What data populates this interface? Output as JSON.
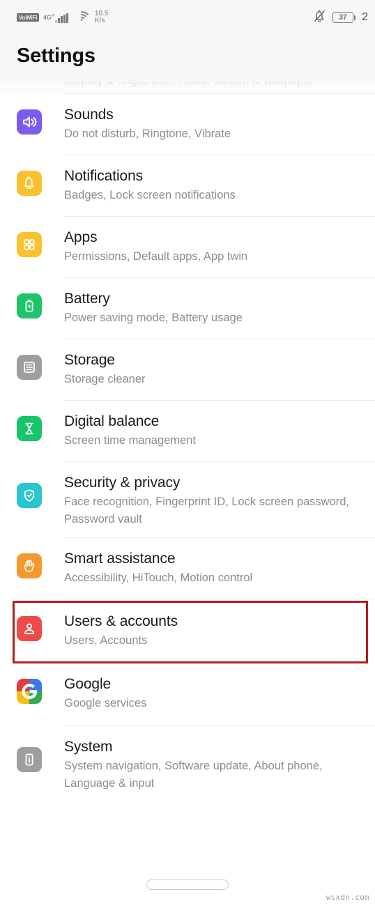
{
  "status_bar": {
    "volte_label": "VoWiFi",
    "network_label": "4G",
    "network_sup": "+",
    "speed_value": "10.5",
    "speed_unit": "K/s",
    "signal_icon": "signal-bars-icon",
    "wifi_icon": "wifi-icon",
    "mute_icon": "bell-muted-icon",
    "battery_level": "37",
    "battery_icon": "battery-icon",
    "clock_fragment": "2"
  },
  "header": {
    "title": "Settings"
  },
  "ghost_row": {
    "text": "Display & brightness, Home screen & wallpaper"
  },
  "list": {
    "items": [
      {
        "title": "Sounds",
        "subtitle": "Do not disturb, Ringtone, Vibrate",
        "icon": "speaker-icon",
        "icon_color": "#7c5cf0",
        "name": "list-item-sounds"
      },
      {
        "title": "Notifications",
        "subtitle": "Badges, Lock screen notifications",
        "icon": "bell-icon",
        "icon_color": "#fbc02d",
        "name": "list-item-notifications"
      },
      {
        "title": "Apps",
        "subtitle": "Permissions, Default apps, App twin",
        "icon": "apps-grid-icon",
        "icon_color": "#f9c22e",
        "name": "list-item-apps"
      },
      {
        "title": "Battery",
        "subtitle": "Power saving mode, Battery usage",
        "icon": "battery-bolt-icon",
        "icon_color": "#1ec46a",
        "name": "list-item-battery"
      },
      {
        "title": "Storage",
        "subtitle": "Storage cleaner",
        "icon": "storage-drive-icon",
        "icon_color": "#9e9e9e",
        "name": "list-item-storage"
      },
      {
        "title": "Digital balance",
        "subtitle": "Screen time management",
        "icon": "hourglass-icon",
        "icon_color": "#17c46a",
        "name": "list-item-digital-balance"
      },
      {
        "title": "Security & privacy",
        "subtitle": "Face recognition, Fingerprint ID, Lock screen password, Password vault",
        "icon": "shield-check-icon",
        "icon_color": "#2ac5ce",
        "name": "list-item-security-privacy"
      },
      {
        "title": "Smart assistance",
        "subtitle": "Accessibility, HiTouch, Motion control",
        "icon": "hand-icon",
        "icon_color": "#f5992e",
        "name": "list-item-smart-assistance"
      },
      {
        "title": "Users & accounts",
        "subtitle": "Users, Accounts",
        "icon": "person-icon",
        "icon_color": "#ef4a4a",
        "name": "list-item-users-accounts",
        "highlighted": true
      },
      {
        "title": "Google",
        "subtitle": "Google services",
        "icon": "google-g-icon",
        "icon_color": "#ffffff",
        "name": "list-item-google"
      },
      {
        "title": "System",
        "subtitle": "System navigation, Software update, About phone, Language & input",
        "icon": "phone-info-icon",
        "icon_color": "#9e9e9e",
        "name": "list-item-system"
      }
    ]
  },
  "highlight": {
    "color": "#b41e20",
    "target": "Users & accounts"
  },
  "navbar": {
    "home_indicator": "home-pill-icon"
  },
  "watermark": {
    "text": "wsxdn.com"
  },
  "colors": {
    "page_bg": "#ffffff",
    "header_bg": "#f7f7f7",
    "title_text": "#1a1a1a",
    "subtitle_text": "#8c8c8c",
    "divider": "#ebebeb",
    "highlight": "#b41e20"
  }
}
